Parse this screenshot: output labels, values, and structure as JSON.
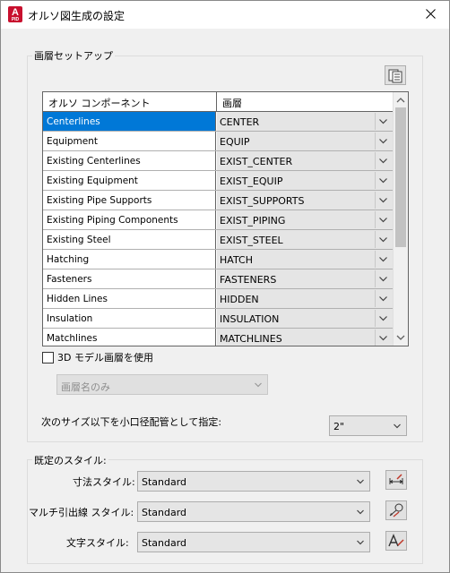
{
  "window": {
    "title": "オルソ図生成の設定",
    "app_icon_text": "A",
    "app_icon_sub": "PID"
  },
  "layer_setup": {
    "group_label": "画層セットアップ",
    "columns": [
      "オルソ コンポーネント",
      "画層"
    ],
    "rows": [
      {
        "component": "Centerlines",
        "layer": "CENTER",
        "selected": true
      },
      {
        "component": "Equipment",
        "layer": "EQUIP"
      },
      {
        "component": "Existing Centerlines",
        "layer": "EXIST_CENTER"
      },
      {
        "component": "Existing Equipment",
        "layer": "EXIST_EQUIP"
      },
      {
        "component": "Existing Pipe Supports",
        "layer": "EXIST_SUPPORTS"
      },
      {
        "component": "Existing Piping Components",
        "layer": "EXIST_PIPING"
      },
      {
        "component": "Existing Steel",
        "layer": "EXIST_STEEL"
      },
      {
        "component": "Hatching",
        "layer": "HATCH"
      },
      {
        "component": "Fasteners",
        "layer": "FASTENERS"
      },
      {
        "component": "Hidden Lines",
        "layer": "HIDDEN"
      },
      {
        "component": "Insulation",
        "layer": "INSULATION"
      },
      {
        "component": "Matchlines",
        "layer": "MATCHLINES"
      }
    ],
    "use_3d_layers_label": "3D モデル画層を使用",
    "use_3d_layers_checked": false,
    "layer_name_option": "画層名のみ",
    "small_bore_label": "次のサイズ以下を小口径配管として指定:",
    "small_bore_value": "2\""
  },
  "default_styles": {
    "group_label": "既定のスタイル:",
    "dimension_style_label": "寸法スタイル:",
    "dimension_style_value": "Standard",
    "multileader_style_label": "マルチ引出線 スタイル:",
    "multileader_style_value": "Standard",
    "text_style_label": "文字スタイル:",
    "text_style_value": "Standard"
  },
  "accent_color": "#0078d7"
}
